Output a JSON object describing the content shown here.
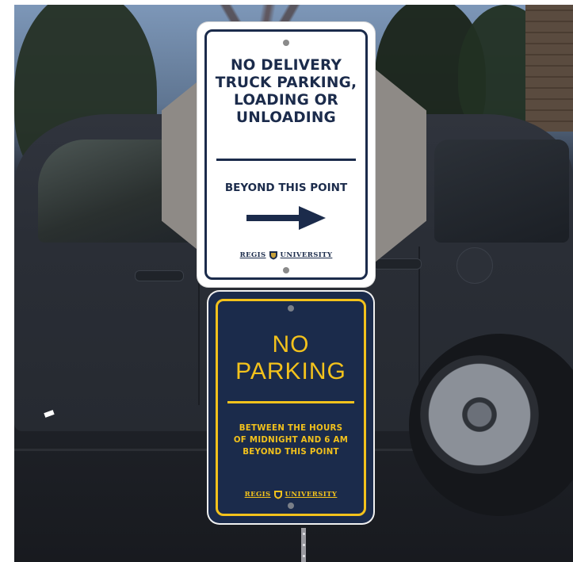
{
  "top_sign": {
    "headline_lines": [
      "NO DELIVERY",
      "TRUCK PARKING,",
      "LOADING OR",
      "UNLOADING"
    ],
    "subtext": "BEYOND THIS POINT",
    "arrow": "right-arrow-icon",
    "brand_left": "REGIS",
    "brand_right": "UNIVERSITY",
    "background_color": "#ffffff",
    "text_color": "#1b2b4b"
  },
  "bottom_sign": {
    "line1": "NO",
    "line2": "PARKING",
    "hours_lines": [
      "BETWEEN THE HOURS",
      "OF MIDNIGHT AND 6 AM",
      "BEYOND THIS POINT"
    ],
    "brand_left": "REGIS",
    "brand_right": "UNIVERSITY",
    "background_color": "#1b2b4b",
    "text_color": "#f3c21c"
  },
  "scene": {
    "vehicle": "dark-gray-suv",
    "backdrop": "trees-and-sky"
  }
}
